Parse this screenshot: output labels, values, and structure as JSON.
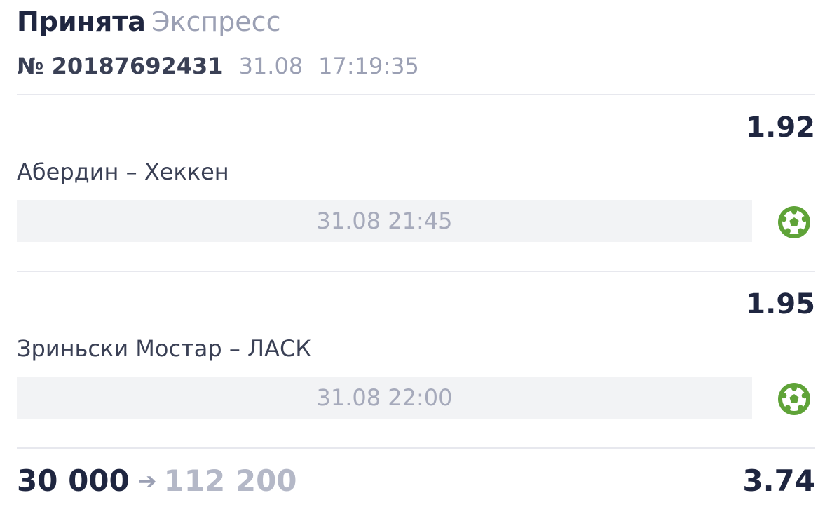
{
  "bet": {
    "status": "Принята",
    "type": "Экспресс",
    "number": "№ 20187692431",
    "date": "31.08",
    "time": "17:19:35"
  },
  "events": [
    {
      "odds": "1.92",
      "match": "Абердин – Хеккен",
      "start": "31.08 21:45",
      "sport_icon": "soccer-ball-icon"
    },
    {
      "odds": "1.95",
      "match": "Зриньски Мостар – ЛАСК",
      "start": "31.08 22:00",
      "sport_icon": "soccer-ball-icon"
    }
  ],
  "summary": {
    "stake": "30 000",
    "arrow": "➔",
    "payout": "112 200",
    "total_odds": "3.74"
  },
  "colors": {
    "primary_text": "#1f2640",
    "secondary_text": "#9ba0b4",
    "date_bar_bg": "#f2f3f5",
    "divider": "#e7e8ee",
    "sport_icon_green": "#5fa338"
  }
}
